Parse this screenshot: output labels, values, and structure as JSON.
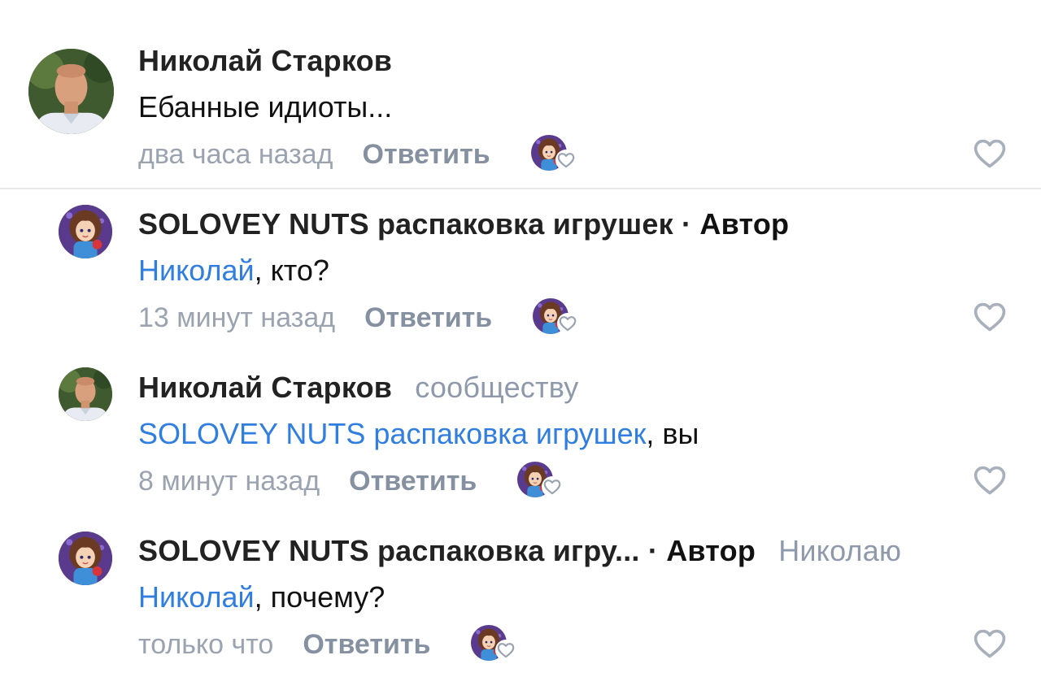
{
  "comments": [
    {
      "author": "Николай Старков",
      "author_tag": "",
      "addressee": "",
      "mention": "",
      "text": "Ебанные идиоты...",
      "time": "два часа назад",
      "reply_label": "Ответить",
      "avatar_icon": "man-photo-avatar"
    },
    {
      "author": "SOLOVEY NUTS распаковка игрушек",
      "author_tag": "Автор",
      "addressee": "",
      "mention": "Николай",
      "text": ", кто?",
      "time": "13 минут назад",
      "reply_label": "Ответить",
      "avatar_icon": "cartoon-girl-avatar"
    },
    {
      "author": "Николай Старков",
      "author_tag": "",
      "addressee": "сообществу",
      "mention": "SOLOVEY NUTS распаковка игрушек",
      "text": ", вы",
      "time": "8 минут назад",
      "reply_label": "Ответить",
      "avatar_icon": "man-photo-avatar"
    },
    {
      "author": "SOLOVEY NUTS распаковка игру...",
      "author_tag": "Автор",
      "addressee": "Николаю",
      "mention": "Николай",
      "text": ", почему?",
      "time": "только что",
      "reply_label": "Ответить",
      "avatar_icon": "cartoon-girl-avatar"
    }
  ],
  "separator": "·",
  "colors": {
    "mention": "#2f7ee0",
    "meta": "#9aa3af",
    "reply": "#8590a0",
    "addressee": "#8e9aab"
  }
}
